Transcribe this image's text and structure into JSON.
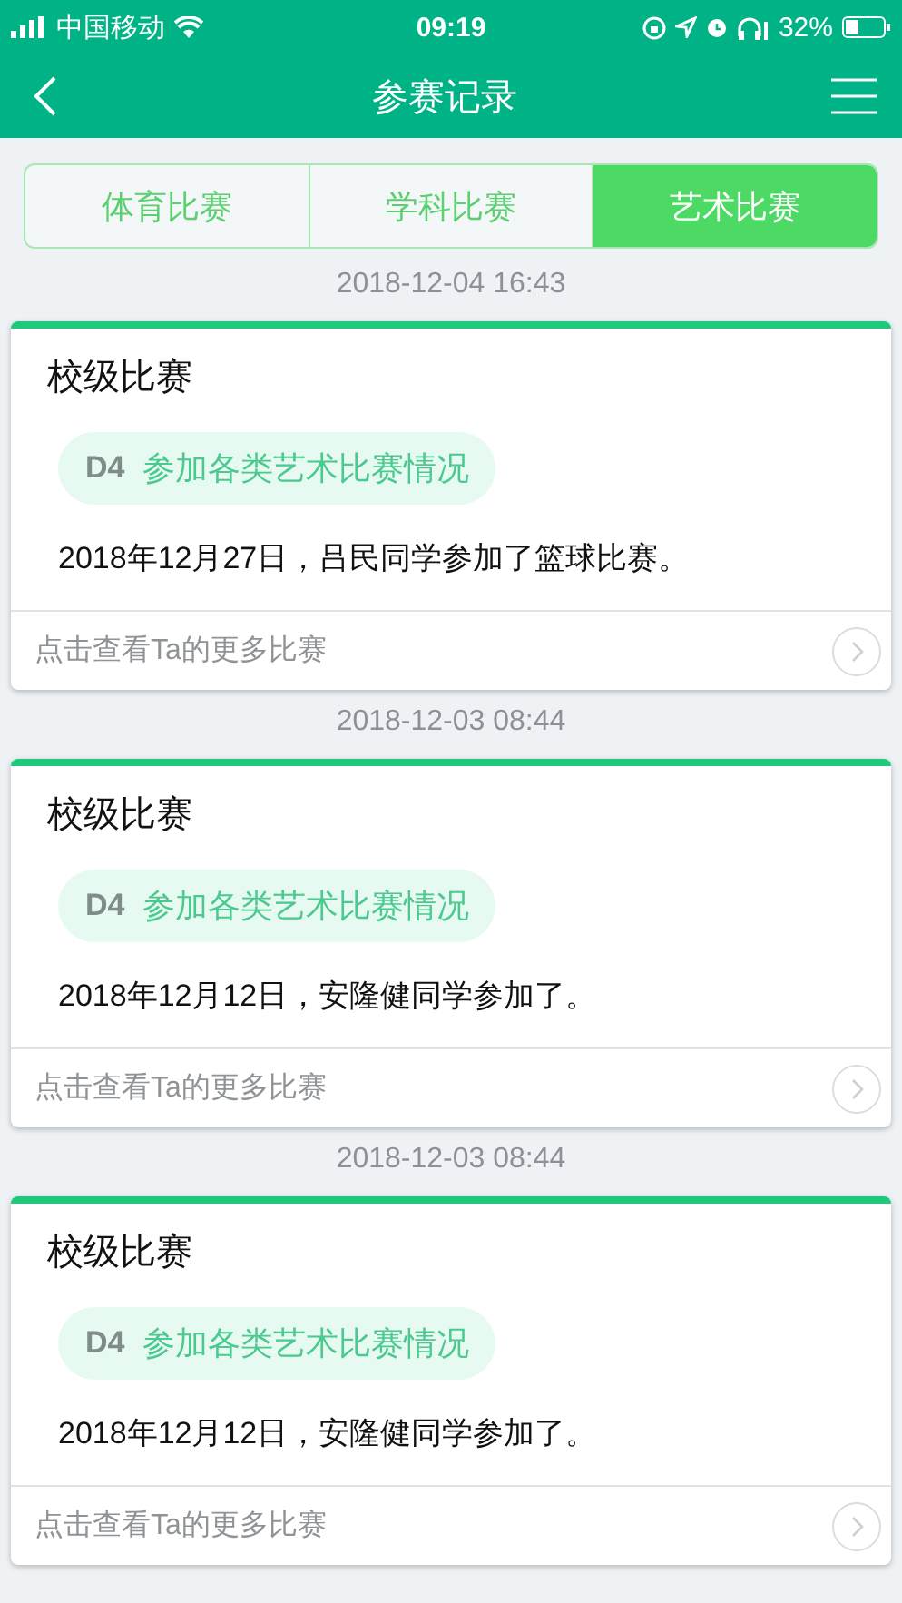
{
  "status_bar": {
    "carrier": "中国移动",
    "time": "09:19",
    "battery_percent": "32%"
  },
  "header": {
    "title": "参赛记录"
  },
  "tabs": [
    {
      "label": "体育比赛",
      "selected": false
    },
    {
      "label": "学科比赛",
      "selected": false
    },
    {
      "label": "艺术比赛",
      "selected": true
    }
  ],
  "records": [
    {
      "time": "2018-12-04 16:43",
      "level": "校级比赛",
      "tag_code": "D4",
      "tag_label": "参加各类艺术比赛情况",
      "text": "2018年12月27日，吕民同学参加了篮球比赛。",
      "more": "点击查看Ta的更多比赛"
    },
    {
      "time": "2018-12-03 08:44",
      "level": "校级比赛",
      "tag_code": "D4",
      "tag_label": "参加各类艺术比赛情况",
      "text": "2018年12月12日，安隆健同学参加了。",
      "more": "点击查看Ta的更多比赛"
    },
    {
      "time": "2018-12-03 08:44",
      "level": "校级比赛",
      "tag_code": "D4",
      "tag_label": "参加各类艺术比赛情况",
      "text": "2018年12月12日，安隆健同学参加了。",
      "more": "点击查看Ta的更多比赛"
    }
  ]
}
